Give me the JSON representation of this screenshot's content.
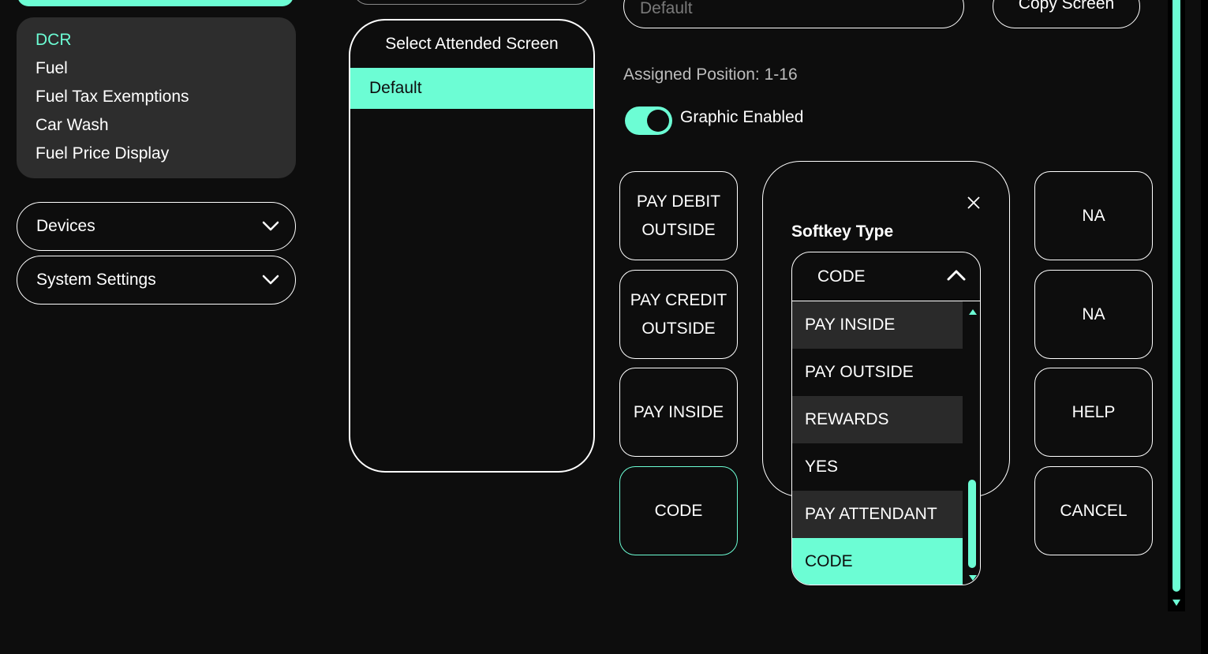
{
  "sidebar": {
    "submenu_items": [
      {
        "label": "DCR",
        "active": true
      },
      {
        "label": "Fuel",
        "active": false
      },
      {
        "label": "Fuel Tax Exemptions",
        "active": false
      },
      {
        "label": "Car Wash",
        "active": false
      },
      {
        "label": "Fuel Price Display",
        "active": false
      }
    ],
    "accordions": [
      {
        "label": "Devices",
        "icon": "chevron-down-icon"
      },
      {
        "label": "System Settings",
        "icon": "chevron-down-icon"
      }
    ]
  },
  "screen_list": {
    "title": "Select Attended Screen",
    "items": [
      "Default"
    ],
    "selected": "Default"
  },
  "form": {
    "screen_name_value": "Default",
    "copy_button": "Copy Screen",
    "assigned_position": "Assigned Position: 1-16",
    "graphic_enabled_label": "Graphic Enabled",
    "graphic_enabled": true
  },
  "softkeys_left": [
    "PAY DEBIT OUTSIDE",
    "PAY CREDIT OUTSIDE",
    "PAY INSIDE",
    "CODE"
  ],
  "softkeys_right": [
    "NA",
    "NA",
    "HELP",
    "CANCEL"
  ],
  "softkey_popup": {
    "title": "Softkey Type",
    "selected_value": "CODE",
    "options": [
      "PAY INSIDE",
      "PAY OUTSIDE",
      "REWARDS",
      "YES",
      "PAY ATTENDANT",
      "CODE"
    ],
    "close_icon": "close-icon"
  },
  "colors": {
    "accent": "#6cfdd4",
    "background": "#0d0d0d",
    "panel": "#2d2d2d"
  }
}
